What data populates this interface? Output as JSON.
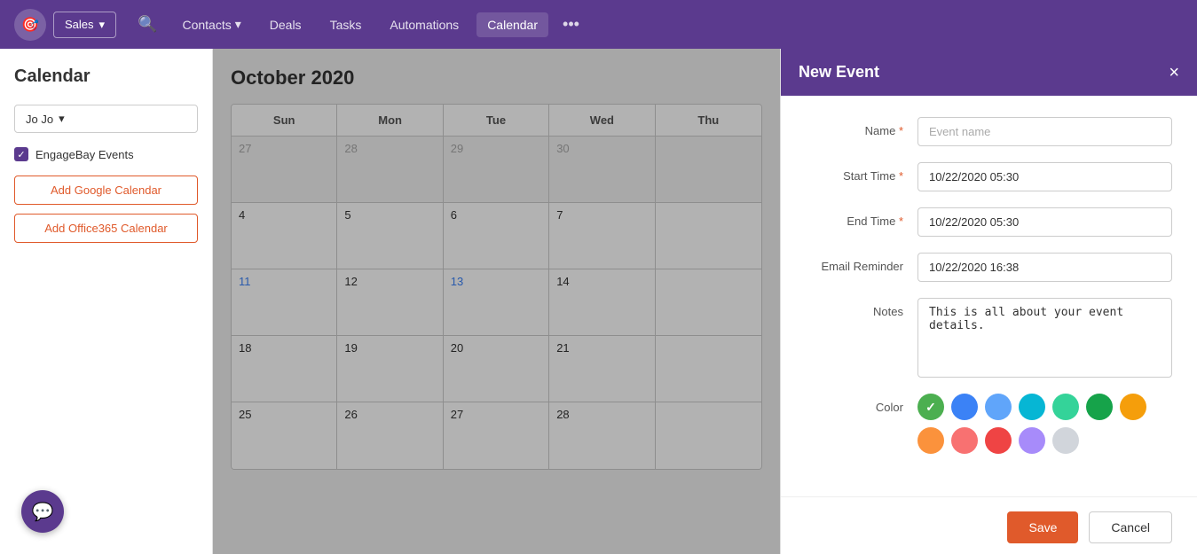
{
  "nav": {
    "logo_icon": "🎯",
    "dropdown_label": "Sales",
    "dropdown_icon": "▾",
    "search_icon": "🔍",
    "links": [
      {
        "label": "Contacts",
        "has_arrow": true,
        "active": false
      },
      {
        "label": "Deals",
        "has_arrow": false,
        "active": false
      },
      {
        "label": "Tasks",
        "has_arrow": false,
        "active": false
      },
      {
        "label": "Automations",
        "has_arrow": false,
        "active": false
      },
      {
        "label": "Calendar",
        "has_arrow": false,
        "active": true
      }
    ],
    "more_icon": "•••"
  },
  "sidebar": {
    "title": "Calendar",
    "user_selector": "Jo Jo",
    "user_arrow": "▾",
    "checkbox_label": "EngageBay Events",
    "btn_google": "Add Google Calendar",
    "btn_office": "Add Office365 Calendar"
  },
  "calendar": {
    "title": "October 2020",
    "headers": [
      "Sun",
      "Mon",
      "Tue",
      "Wed",
      "Thu"
    ],
    "rows": [
      [
        {
          "num": "27",
          "type": "prev"
        },
        {
          "num": "28",
          "type": "prev"
        },
        {
          "num": "29",
          "type": "prev"
        },
        {
          "num": "30",
          "type": "prev"
        },
        {
          "num": "",
          "type": "prev"
        }
      ],
      [
        {
          "num": "4",
          "type": "current"
        },
        {
          "num": "5",
          "type": "current"
        },
        {
          "num": "6",
          "type": "current"
        },
        {
          "num": "7",
          "type": "current"
        },
        {
          "num": "",
          "type": "current"
        }
      ],
      [
        {
          "num": "11",
          "type": "blue"
        },
        {
          "num": "12",
          "type": "current"
        },
        {
          "num": "13",
          "type": "blue"
        },
        {
          "num": "14",
          "type": "current"
        },
        {
          "num": "",
          "type": "current"
        }
      ],
      [
        {
          "num": "18",
          "type": "current"
        },
        {
          "num": "19",
          "type": "current"
        },
        {
          "num": "20",
          "type": "current"
        },
        {
          "num": "21",
          "type": "current"
        },
        {
          "num": "",
          "type": "current"
        }
      ],
      [
        {
          "num": "25",
          "type": "current"
        },
        {
          "num": "26",
          "type": "current"
        },
        {
          "num": "27",
          "type": "current"
        },
        {
          "num": "28",
          "type": "current"
        },
        {
          "num": "",
          "type": "current"
        }
      ]
    ]
  },
  "event_panel": {
    "title": "New Event",
    "close_icon": "×",
    "fields": {
      "name_label": "Name",
      "name_placeholder": "Event name",
      "start_time_label": "Start Time",
      "start_time_value": "10/22/2020 05:30",
      "end_time_label": "End Time",
      "end_time_value": "10/22/2020 05:30",
      "email_reminder_label": "Email Reminder",
      "email_reminder_value": "10/22/2020 16:38",
      "notes_label": "Notes",
      "notes_value": "This is all about your event details.",
      "color_label": "Color"
    },
    "colors": [
      {
        "hex": "#4caf50",
        "selected": true
      },
      {
        "hex": "#3b82f6",
        "selected": false
      },
      {
        "hex": "#60a5fa",
        "selected": false
      },
      {
        "hex": "#06b6d4",
        "selected": false
      },
      {
        "hex": "#34d399",
        "selected": false
      },
      {
        "hex": "#16a34a",
        "selected": false
      },
      {
        "hex": "#f59e0b",
        "selected": false
      },
      {
        "hex": "#fb923c",
        "selected": false
      },
      {
        "hex": "#f87171",
        "selected": false
      },
      {
        "hex": "#ef4444",
        "selected": false
      },
      {
        "hex": "#a78bfa",
        "selected": false
      },
      {
        "hex": "#d1d5db",
        "selected": false
      }
    ],
    "save_label": "Save",
    "cancel_label": "Cancel"
  },
  "chat": {
    "icon": "💬"
  }
}
